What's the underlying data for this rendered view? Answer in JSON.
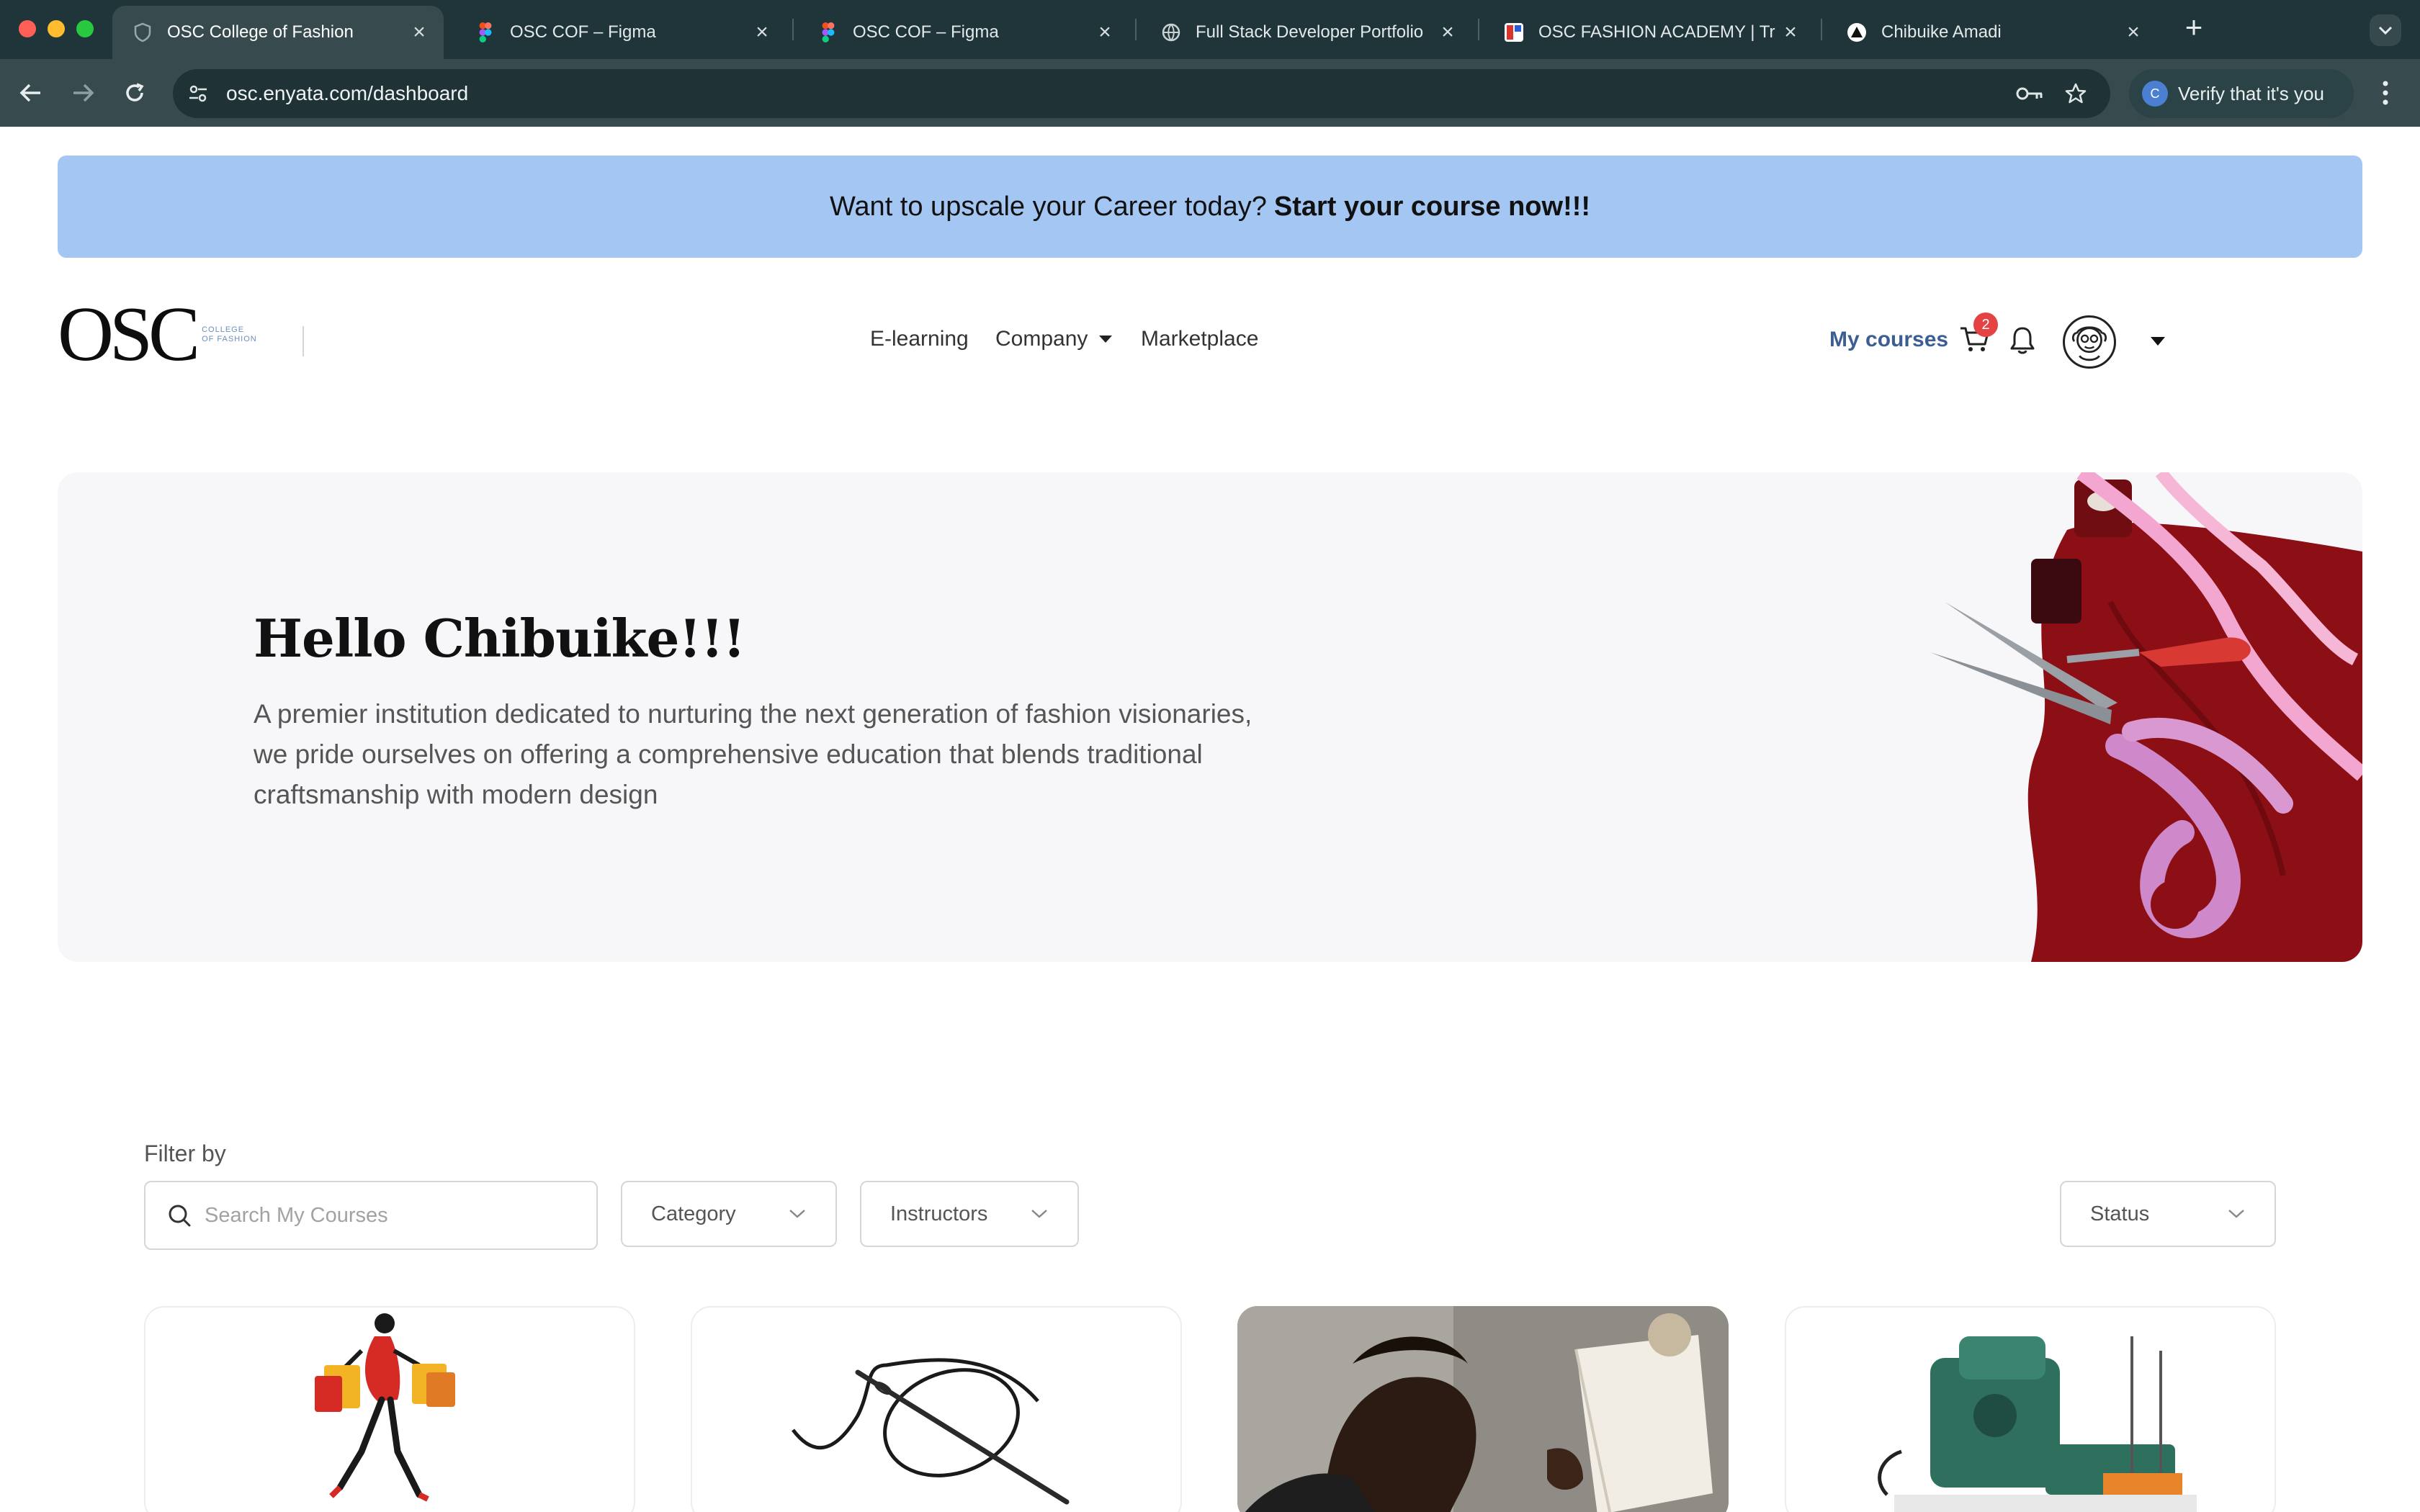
{
  "browser": {
    "tabs": [
      {
        "title": "OSC College of Fashion",
        "active": true,
        "icon": "shield-icon"
      },
      {
        "title": "OSC COF – Figma",
        "active": false,
        "icon": "figma-icon"
      },
      {
        "title": "OSC COF – Figma",
        "active": false,
        "icon": "figma-icon"
      },
      {
        "title": "Full Stack Developer Portfolio",
        "active": false,
        "icon": "globe-icon"
      },
      {
        "title": "OSC FASHION ACADEMY | Tr",
        "active": false,
        "icon": "academy-icon"
      },
      {
        "title": "Chibuike Amadi",
        "active": false,
        "icon": "triangle-icon"
      }
    ],
    "url": "osc.enyata.com/dashboard",
    "verify_label": "Verify that it's you",
    "verify_initial": "C"
  },
  "banner": {
    "text": "Want to upscale your Career today?",
    "cta": "Start your course now!!!"
  },
  "header": {
    "logo_text": "OSC",
    "logo_sub_line1": "COLLEGE",
    "logo_sub_line2": "OF FASHION",
    "nav": [
      "E-learning",
      "Company",
      "Marketplace"
    ],
    "my_courses": "My courses",
    "cart_count": "2"
  },
  "hero": {
    "greeting": "Hello Chibuike!!!",
    "description": "A premier institution dedicated to nurturing the next generation of fashion visionaries, we pride ourselves on offering a comprehensive education that blends traditional craftsmanship with modern design"
  },
  "filters": {
    "label": "Filter by",
    "search_placeholder": "Search My Courses",
    "category": "Category",
    "instructors": "Instructors",
    "status": "Status"
  },
  "colors": {
    "banner": "#a4c6f2",
    "accent": "#3b5f93",
    "badge": "#e54343"
  }
}
